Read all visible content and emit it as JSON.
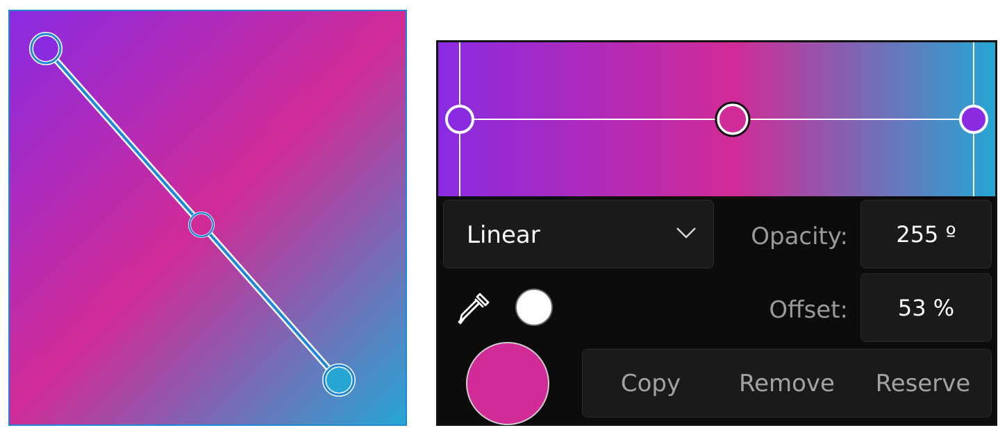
{
  "gradient": {
    "type": "Linear",
    "stops": [
      {
        "color": "#8a2be2",
        "offset_percent": 0
      },
      {
        "color": "#d02b96",
        "offset_percent": 53
      },
      {
        "color": "#26a6d3",
        "offset_percent": 100
      }
    ],
    "accent_color": "#1e88d6"
  },
  "type_select": {
    "value": "Linear",
    "icon": "chevron-down-icon"
  },
  "opacity": {
    "label": "Opacity:",
    "value": "255 º"
  },
  "offset": {
    "label": "Offset:",
    "value": "53 %"
  },
  "tools": {
    "eyedropper_icon": "eyedropper-icon",
    "white_swatch_color": "#ffffff",
    "current_color": "#d02b96"
  },
  "actions": {
    "copy": "Copy",
    "remove": "Remove",
    "reserve": "Reserve"
  }
}
